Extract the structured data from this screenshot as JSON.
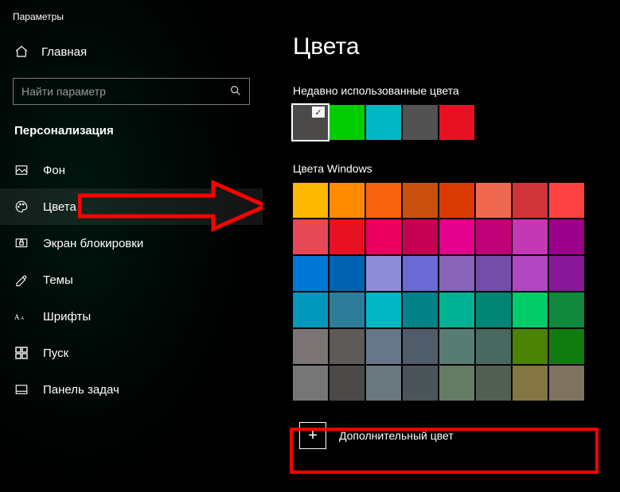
{
  "window_title": "Параметры",
  "home_label": "Главная",
  "search": {
    "placeholder": "Найти параметр"
  },
  "section_title": "Персонализация",
  "nav": [
    {
      "label": "Фон",
      "icon": "background-icon"
    },
    {
      "label": "Цвета",
      "icon": "colors-icon"
    },
    {
      "label": "Экран блокировки",
      "icon": "lockscreen-icon"
    },
    {
      "label": "Темы",
      "icon": "themes-icon"
    },
    {
      "label": "Шрифты",
      "icon": "fonts-icon"
    },
    {
      "label": "Пуск",
      "icon": "start-icon"
    },
    {
      "label": "Панель задач",
      "icon": "taskbar-icon"
    }
  ],
  "nav_active_index": 1,
  "page_title": "Цвета",
  "recent_label": "Недавно использованные цвета",
  "recent_colors": [
    {
      "hex": "#4c4a48",
      "selected": true
    },
    {
      "hex": "#00cc00"
    },
    {
      "hex": "#00b7c3"
    },
    {
      "hex": "#525252"
    },
    {
      "hex": "#e81123"
    }
  ],
  "windows_colors_label": "Цвета Windows",
  "windows_colors": [
    "#ffb900",
    "#ff8c00",
    "#f7630c",
    "#ca5010",
    "#da3b01",
    "#ef6950",
    "#d13438",
    "#ff4343",
    "#e74856",
    "#e81123",
    "#ea005e",
    "#c30052",
    "#e3008c",
    "#bf0077",
    "#c239b3",
    "#9a0089",
    "#0078d7",
    "#0063b1",
    "#8e8cd8",
    "#6b69d6",
    "#8764b8",
    "#744da9",
    "#b146c2",
    "#881798",
    "#0099bc",
    "#2d7d9a",
    "#00b7c3",
    "#038387",
    "#00b294",
    "#018574",
    "#00cc6a",
    "#10893e",
    "#7a7574",
    "#5d5a58",
    "#68768a",
    "#515c6b",
    "#567c73",
    "#486860",
    "#498205",
    "#107c10",
    "#767676",
    "#4c4a48",
    "#69797e",
    "#4a5459",
    "#647c64",
    "#525e54",
    "#847545",
    "#7e735f"
  ],
  "custom_color_label": "Дополнительный цвет"
}
